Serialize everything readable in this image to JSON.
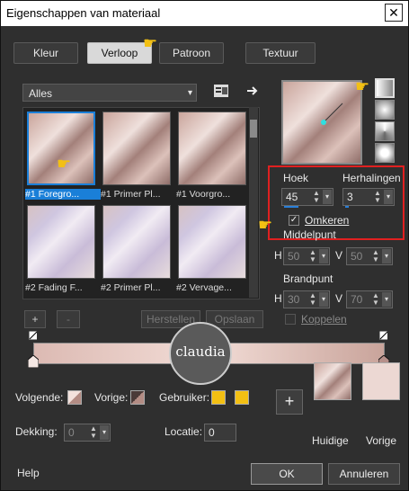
{
  "window": {
    "title": "Eigenschappen van materiaal",
    "close_glyph": "✕"
  },
  "tabs": [
    "Kleur",
    "Verloop",
    "Patroon",
    "Textuur"
  ],
  "active_tab": "Verloop",
  "category_select": {
    "value": "Alles"
  },
  "gallery": {
    "items": [
      {
        "caption": "#1 Foregro...",
        "style": "grad1",
        "selected": true
      },
      {
        "caption": "#1 Primer Pl...",
        "style": "grad1",
        "selected": false
      },
      {
        "caption": "#1 Voorgro...",
        "style": "grad1",
        "selected": false
      },
      {
        "caption": "#2 Fading F...",
        "style": "grad2",
        "selected": false
      },
      {
        "caption": "#2 Primer Pl...",
        "style": "grad2",
        "selected": false
      },
      {
        "caption": "#2 Vervage...",
        "style": "grad2",
        "selected": false
      }
    ]
  },
  "gallery_buttons": {
    "add": "+",
    "remove": "-",
    "reset": "Herstellen",
    "save": "Opslaan"
  },
  "gradient_settings": {
    "angle_label": "Hoek",
    "angle_value": "45",
    "repeats_label": "Herhalingen",
    "repeats_value": "3",
    "invert_label": "Omkeren",
    "invert_checked": true,
    "center_label": "Middelpunt",
    "center_h_label": "H",
    "center_h_value": "50",
    "center_v_label": "V",
    "center_v_value": "50",
    "focal_label": "Brandpunt",
    "focal_h_label": "H",
    "focal_h_value": "30",
    "focal_v_label": "V",
    "focal_v_value": "70",
    "link_label": "Koppelen",
    "link_checked": false
  },
  "bottom": {
    "following_label": "Volgende:",
    "previous_label": "Vorige:",
    "user_label": "Gebruiker:",
    "opacity_label": "Dekking:",
    "opacity_value": "0",
    "location_label": "Locatie:",
    "location_value": "0",
    "current_label": "Huidige",
    "previous_swatch_label": "Vorige",
    "add_glyph": "+"
  },
  "footer": {
    "help": "Help",
    "ok": "OK",
    "cancel": "Annuleren"
  },
  "watermark": {
    "text": "claudia"
  },
  "colors": {
    "accent": "#1a7fd8",
    "highlight_box": "#e02020",
    "user_swatch": "#f3c013"
  }
}
